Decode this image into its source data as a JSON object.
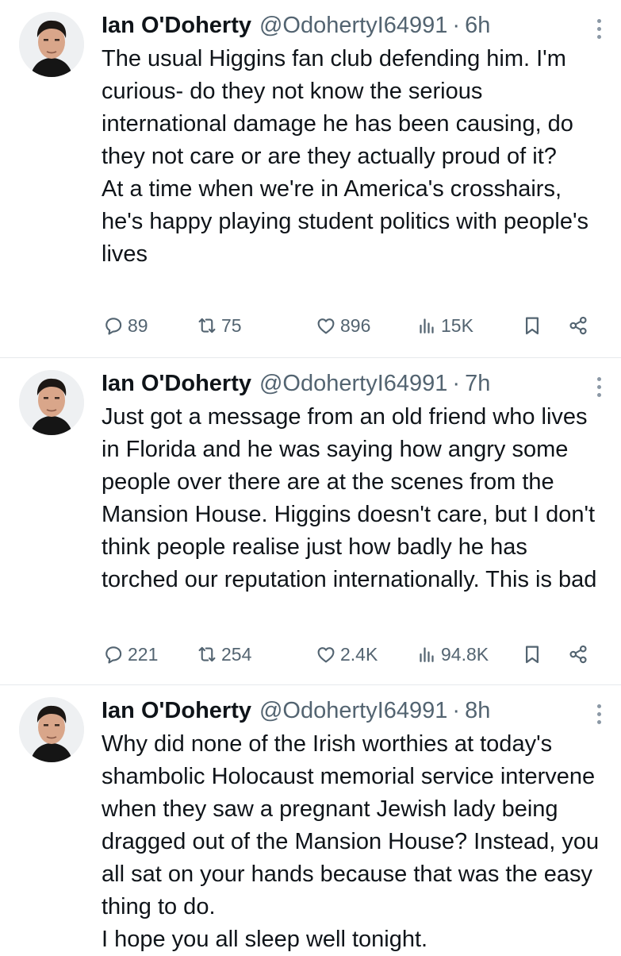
{
  "tweets": [
    {
      "name": "Ian O'Doherty",
      "handle": "@OdohertyI64991",
      "time": "6h",
      "lines": [
        "The usual Higgins fan club defending him. I'm curious- do they not know the serious international damage he has been causing, do they not care or are they actually proud of it?",
        "At a time when we're in America's crosshairs, he's happy playing student politics with people's lives"
      ],
      "replies": "89",
      "reposts": "75",
      "likes": "896",
      "views": "15K"
    },
    {
      "name": "Ian O'Doherty",
      "handle": "@OdohertyI64991",
      "time": "7h",
      "lines": [
        "Just got a message from an old friend who lives in Florida and he was saying how angry some people over there are at the scenes from the Mansion House. Higgins doesn't care, but I don't think people realise just how badly he has torched our reputation internationally. This is bad"
      ],
      "replies": "221",
      "reposts": "254",
      "likes": "2.4K",
      "views": "94.8K"
    },
    {
      "name": "Ian O'Doherty",
      "handle": "@OdohertyI64991",
      "time": "8h",
      "lines": [
        "Why did none of the Irish worthies at today's shambolic Holocaust memorial service intervene when they saw a pregnant Jewish lady being dragged out of the Mansion House? Instead, you all sat on your hands because that was the easy thing to do.",
        "I hope you all sleep well tonight."
      ]
    }
  ],
  "separator": "·",
  "colors": {
    "text": "#0f1419",
    "secondary": "#536471",
    "divider": "#e6e9ec"
  },
  "icons": [
    "more-icon",
    "reply-icon",
    "repost-icon",
    "like-icon",
    "views-icon",
    "bookmark-icon",
    "share-icon"
  ]
}
